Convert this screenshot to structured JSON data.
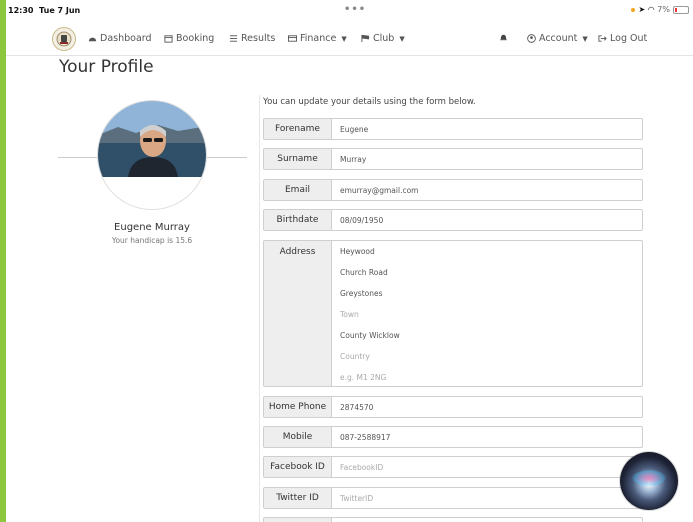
{
  "status_bar": {
    "time": "12:30",
    "date": "Tue 7 Jun",
    "battery_pct": "7%"
  },
  "nav": {
    "dashboard": "Dashboard",
    "booking": "Booking",
    "results": "Results",
    "finance": "Finance",
    "club": "Club",
    "account": "Account",
    "logout": "Log Out"
  },
  "page": {
    "title": "Your Profile",
    "intro": "You can update your details using the form below."
  },
  "profile": {
    "name": "Eugene Murray",
    "handicap": "Your handicap is 15.6"
  },
  "form": {
    "forename": {
      "label": "Forename",
      "value": "Eugene"
    },
    "surname": {
      "label": "Surname",
      "value": "Murray"
    },
    "email": {
      "label": "Email",
      "value": "emurray@gmail.com"
    },
    "birthdate": {
      "label": "Birthdate",
      "value": "08/09/1950"
    },
    "address": {
      "label": "Address",
      "line1": "Heywood",
      "line2": "Church Road",
      "line3": "Greystones",
      "town_placeholder": "Town",
      "county": "County Wicklow",
      "country_placeholder": "Country",
      "postcode_placeholder": "e.g. M1 2NG"
    },
    "home_phone": {
      "label": "Home Phone",
      "value": "2874570"
    },
    "mobile": {
      "label": "Mobile",
      "value": "087-2588917"
    },
    "facebook": {
      "label": "Facebook ID",
      "placeholder": "FacebookID"
    },
    "twitter": {
      "label": "Twitter ID",
      "placeholder": "TwitterID"
    }
  }
}
